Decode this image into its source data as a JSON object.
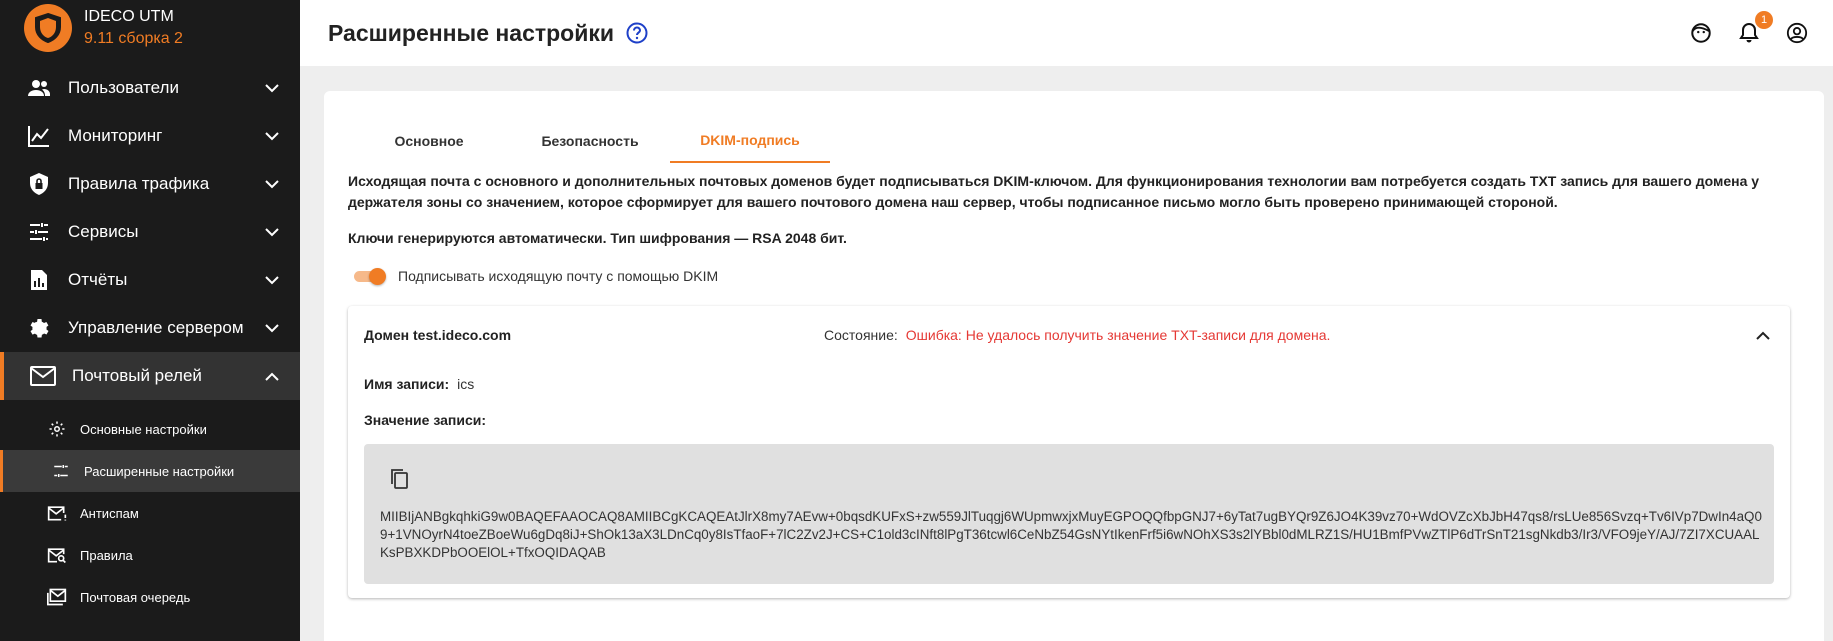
{
  "brand": {
    "name": "IDECO UTM",
    "version": "9.11 сборка 2"
  },
  "sidebar": {
    "items": [
      {
        "label": "Пользователи",
        "icon": "users-icon"
      },
      {
        "label": "Мониторинг",
        "icon": "chart-line-icon"
      },
      {
        "label": "Правила трафика",
        "icon": "shield-lock-icon"
      },
      {
        "label": "Сервисы",
        "icon": "sliders-icon"
      },
      {
        "label": "Отчёты",
        "icon": "report-icon"
      },
      {
        "label": "Управление сервером",
        "icon": "gear-icon"
      },
      {
        "label": "Почтовый релей",
        "icon": "mail-icon"
      }
    ],
    "subitems": [
      {
        "label": "Основные настройки",
        "icon": "gear-icon"
      },
      {
        "label": "Расширенные настройки",
        "icon": "sliders-icon"
      },
      {
        "label": "Антиспам",
        "icon": "mail-alert-icon"
      },
      {
        "label": "Правила",
        "icon": "mail-search-icon"
      },
      {
        "label": "Почтовая очередь",
        "icon": "mail-queue-icon"
      }
    ]
  },
  "header": {
    "title": "Расширенные настройки",
    "notifications_count": "1"
  },
  "tabs": [
    {
      "label": "Основное"
    },
    {
      "label": "Безопасность"
    },
    {
      "label": "DKIM-подпись"
    }
  ],
  "content": {
    "description": "Исходящая почта с основного и дополнительных почтовых доменов будет подписываться DKIM-ключом. Для функционирования технологии вам потребуется создать TXT запись для вашего домена у держателя зоны со значением, которое сформирует для вашего почтового домена наш сервер, чтобы подписанное письмо могло быть проверено принимающей стороной.",
    "keys_note": "Ключи генерируются автоматически. Тип шифрования — RSA 2048 бит.",
    "toggle_label": "Подписывать исходящую почту с помощью DKIM",
    "toggle_on": true
  },
  "domain": {
    "title": "Домен test.ideco.com",
    "state_label": "Состояние:",
    "state_value": "Ошибка: Не удалось получить значение TXT-записи для домена.",
    "record_name_label": "Имя записи:",
    "record_name_value": "ics",
    "record_value_label": "Значение записи:",
    "record_value": "MIIBIjANBgkqhkiG9w0BAQEFAAOCAQ8AMIIBCgKCAQEAtJlrX8my7AEvw+0bqsdKUFxS+zw559JlTuqgj6WUpmwxjxMuyEGPOQQfbpGNJ7+6yTat7ugBYQr9Z6JO4K39vz70+WdOVZcXbJbH47qs8/rsLUe856Svzq+Tv6IVp7DwIn4aQ09+1VNOyrN4toeZBoeWu6gDq8iJ+ShOk13aX3LDnCq0y8IsTfaoF+7lC2Zv2J+CS+C1old3cINft8lPgT36tcwl6CeNbZ54GsNYtIkenFrf5i6wNOhXS3s2lYBbl0dMLRZ1S/HU1BmfPVwZTlP6dTrSnT21sgNkdb3/Ir3/VFO9jeY/AJ/7ZI7XCUAALKsPBXKDPbOOElOL+TfxOQIDAQAB"
  },
  "colors": {
    "accent": "#f07c24",
    "sidebar_bg": "#1b1b1b",
    "error": "#e53935"
  }
}
